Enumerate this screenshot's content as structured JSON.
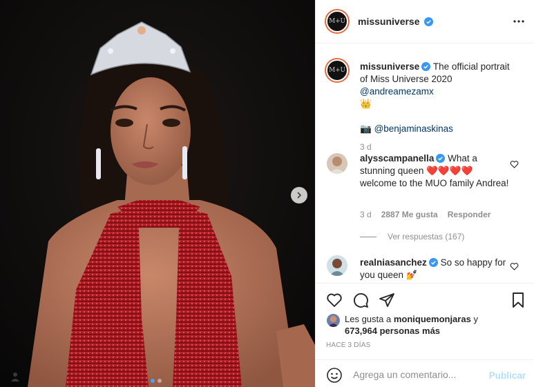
{
  "post": {
    "author": "missuniverse",
    "avatar_text": "M+U",
    "caption_text": "The official portrait of Miss Universe 2020",
    "caption_mention": "@andreamezamx",
    "caption_emoji": "👑",
    "photo_emoji": "📷",
    "photo_credit": "@benjaminaskinas",
    "caption_age": "3 d"
  },
  "icons": {
    "verified": "verified-badge-icon",
    "more": "more-options-icon",
    "next": "chevron-right-icon",
    "like": "heart-icon",
    "comment": "speech-bubble-icon",
    "share": "paper-plane-icon",
    "save": "bookmark-icon",
    "emoji": "smiley-icon",
    "user_tags": "user-silhouette-icon"
  },
  "comments": [
    {
      "author": "alysscampanella",
      "text_before": "What a stunning queen",
      "hearts": "❤️❤️❤️❤️",
      "text_after": "welcome to the MUO family Andrea!",
      "age": "3 d",
      "likes": "2887 Me gusta",
      "reply": "Responder",
      "view_replies": "Ver respuestas (167)"
    },
    {
      "author": "realniasanchez",
      "text": "So so happy for you queen",
      "emoji": "💅"
    }
  ],
  "likes": {
    "prefix": "Les gusta a",
    "user": "moniquemonjaras",
    "conj": "y",
    "count": "673,964 personas más"
  },
  "timestamp": "HACE 3 DÍAS",
  "comment_box": {
    "placeholder": "Agrega un comentario...",
    "post_label": "Publicar"
  },
  "carousel": {
    "slides": 2,
    "active": 0
  },
  "colors": {
    "link": "#00376b",
    "verified": "#3897f0",
    "post_disabled": "#b2dffc",
    "dress": "#b3161c",
    "background_photo": "#0e0c0c"
  }
}
